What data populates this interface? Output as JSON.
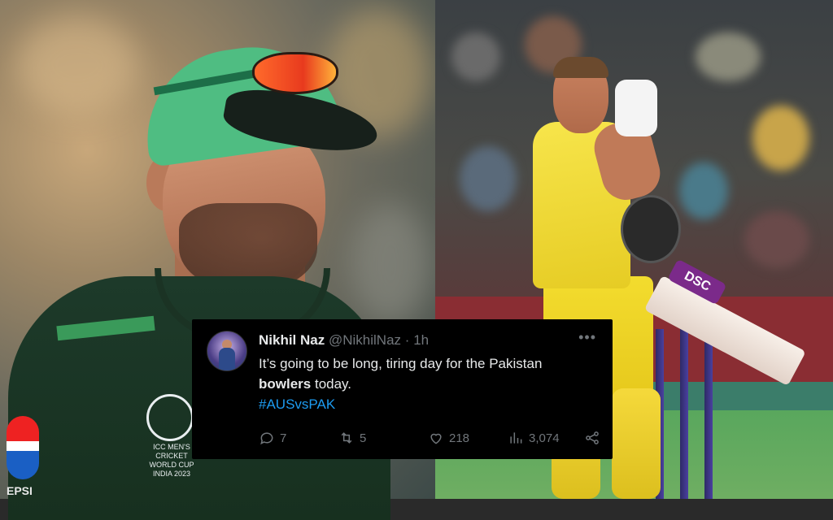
{
  "tweet": {
    "name": "Nikhil Naz",
    "handle": "@NikhilNaz",
    "separator": "·",
    "time": "1h",
    "more_icon": "more-horizontal-icon",
    "text_part1": "It’s going to be long, tiring day for the Pakistan ",
    "text_bold": "bowlers",
    "text_part2": " today.",
    "hashtag": "#AUSvsPAK",
    "actions": {
      "replies": "7",
      "retweets": "5",
      "likes": "218",
      "views": "3,074"
    }
  },
  "left_photo": {
    "sponsor_label": "EPSI",
    "badge_text": "ICC MEN'S CRICKET WORLD CUP INDIA 2023"
  },
  "right_photo": {
    "bat_sticker": "DSC"
  },
  "colors": {
    "tweet_bg": "#000000",
    "text": "#e7e9ea",
    "muted": "#71767b",
    "link": "#1d9bf0"
  }
}
